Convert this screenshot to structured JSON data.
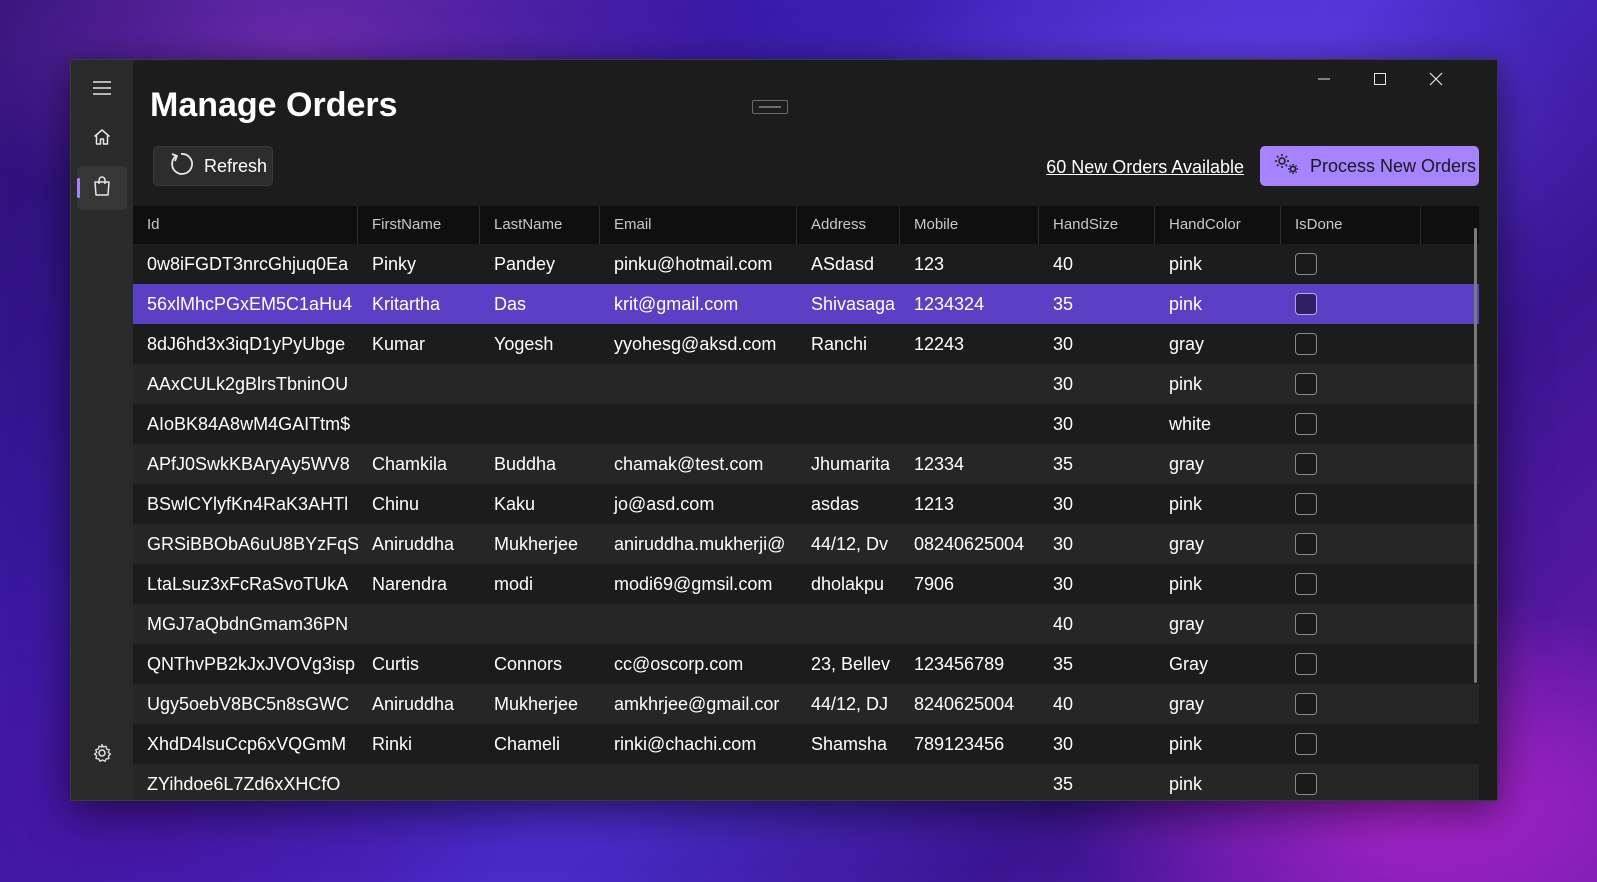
{
  "window": {
    "title": "Manage Orders",
    "controls": {
      "minimize": "minimize-icon",
      "maximize": "maximize-icon",
      "close": "close-icon"
    }
  },
  "nav": {
    "items": [
      {
        "icon": "hamburger-menu-icon"
      },
      {
        "icon": "home-icon"
      },
      {
        "icon": "shopping-bag-icon",
        "active": true
      },
      {
        "icon": "settings-gear-icon"
      }
    ]
  },
  "toolbar": {
    "refresh_label": "Refresh",
    "new_orders_link": "60 New Orders Available",
    "process_label": "Process New Orders"
  },
  "colors": {
    "accent": "#a683ff",
    "selected_row": "#5b3fc4",
    "background": "#1c1c1c"
  },
  "grid": {
    "columns": [
      "Id",
      "FirstName",
      "LastName",
      "Email",
      "Address",
      "Mobile",
      "HandSize",
      "HandColor",
      "IsDone"
    ],
    "rows": [
      {
        "id": "0w8iFGDT3nrcGhjuq0Ea",
        "first": "Pinky",
        "last": "Pandey",
        "email": "pinku@hotmail.com",
        "address": "ASdasd",
        "mobile": "123",
        "size": "40",
        "color": "pink",
        "done": false
      },
      {
        "id": "56xlMhcPGxEM5C1aHu4",
        "first": "Kritartha",
        "last": "Das",
        "email": "krit@gmail.com",
        "address": "Shivasaga",
        "mobile": "1234324",
        "size": "35",
        "color": "pink",
        "done": false,
        "selected": true
      },
      {
        "id": "8dJ6hd3x3iqD1yPyUbge",
        "first": "Kumar",
        "last": "Yogesh",
        "email": "yyohesg@aksd.com",
        "address": "Ranchi",
        "mobile": "12243",
        "size": "30",
        "color": "gray",
        "done": false
      },
      {
        "id": "AAxCULk2gBlrsTbninOU",
        "first": "",
        "last": "",
        "email": "",
        "address": "",
        "mobile": "",
        "size": "30",
        "color": "pink",
        "done": false
      },
      {
        "id": "AIoBK84A8wM4GAITtm$",
        "first": "",
        "last": "",
        "email": "",
        "address": "",
        "mobile": "",
        "size": "30",
        "color": "white",
        "done": false
      },
      {
        "id": "APfJ0SwkKBAryAy5WV8",
        "first": "Chamkila",
        "last": "Buddha",
        "email": "chamak@test.com",
        "address": "Jhumarita",
        "mobile": "12334",
        "size": "35",
        "color": "gray",
        "done": false
      },
      {
        "id": "BSwlCYlyfKn4RaK3AHTl",
        "first": "Chinu",
        "last": "Kaku",
        "email": "jo@asd.com",
        "address": "asdas",
        "mobile": "1213",
        "size": "30",
        "color": "pink",
        "done": false
      },
      {
        "id": "GRSiBBObA6uU8BYzFqS",
        "first": "Aniruddha",
        "last": "Mukherjee",
        "email": "aniruddha.mukherji@",
        "address": "44/12, Dv",
        "mobile": "08240625004",
        "size": "30",
        "color": "gray",
        "done": false
      },
      {
        "id": "LtaLsuz3xFcRaSvoTUkA",
        "first": "Narendra",
        "last": "modi",
        "email": "modi69@gmsil.com",
        "address": "dholakpu",
        "mobile": "7906",
        "size": "30",
        "color": "pink",
        "done": false
      },
      {
        "id": "MGJ7aQbdnGmam36PN",
        "first": "",
        "last": "",
        "email": "",
        "address": "",
        "mobile": "",
        "size": "40",
        "color": "gray",
        "done": false
      },
      {
        "id": "QNThvPB2kJxJVOVg3isp",
        "first": "Curtis",
        "last": "Connors",
        "email": "cc@oscorp.com",
        "address": "23, Bellev",
        "mobile": "123456789",
        "size": "35",
        "color": "Gray",
        "done": false
      },
      {
        "id": "Ugy5oebV8BC5n8sGWC",
        "first": "Aniruddha",
        "last": "Mukherjee",
        "email": "amkhrjee@gmail.cor",
        "address": "44/12, DJ",
        "mobile": "8240625004",
        "size": "40",
        "color": "gray",
        "done": false
      },
      {
        "id": "XhdD4lsuCcp6xVQGmM",
        "first": "Rinki",
        "last": "Chameli",
        "email": "rinki@chachi.com",
        "address": "Shamsha",
        "mobile": "789123456",
        "size": "30",
        "color": "pink",
        "done": false
      },
      {
        "id": "ZYihdoe6L7Zd6xXHCfO",
        "first": "",
        "last": "",
        "email": "",
        "address": "",
        "mobile": "",
        "size": "35",
        "color": "pink",
        "done": false
      }
    ]
  }
}
